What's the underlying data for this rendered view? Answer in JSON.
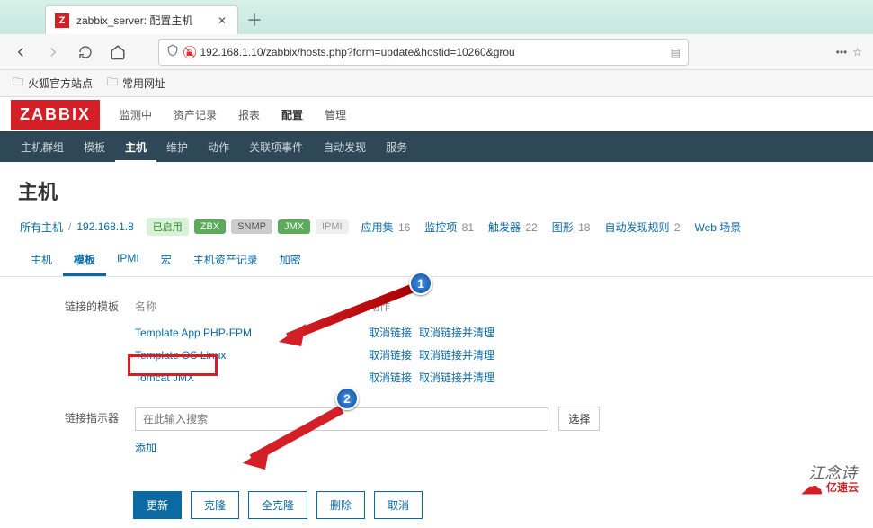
{
  "browser": {
    "tab_title": "zabbix_server: 配置主机",
    "url_readable": "192.168.1.10/zabbix/hosts.php?form=update&hostid=10260&grou",
    "bookmarks": [
      {
        "label": "火狐官方站点",
        "icon": "folder-icon"
      },
      {
        "label": "常用网址",
        "icon": "folder-icon"
      }
    ]
  },
  "zabbix": {
    "logo": "ZABBIX",
    "main_nav": [
      {
        "label": "监测中",
        "active": false
      },
      {
        "label": "资产记录",
        "active": false
      },
      {
        "label": "报表",
        "active": false
      },
      {
        "label": "配置",
        "active": true
      },
      {
        "label": "管理",
        "active": false
      }
    ],
    "sub_nav": [
      {
        "label": "主机群组"
      },
      {
        "label": "模板"
      },
      {
        "label": "主机",
        "active": true
      },
      {
        "label": "维护"
      },
      {
        "label": "动作"
      },
      {
        "label": "关联项事件"
      },
      {
        "label": "自动发现"
      },
      {
        "label": "服务"
      }
    ],
    "page_title": "主机",
    "crumb": {
      "all_hosts": "所有主机",
      "hostname": "192.168.1.8",
      "enabled": "已启用",
      "pills": {
        "zbx": "ZBX",
        "snmp": "SNMP",
        "jmx": "JMX",
        "ipmi": "IPMI"
      },
      "links": [
        {
          "label": "应用集",
          "count": "16"
        },
        {
          "label": "监控项",
          "count": "81"
        },
        {
          "label": "触发器",
          "count": "22"
        },
        {
          "label": "图形",
          "count": "18"
        },
        {
          "label": "自动发现规则",
          "count": "2"
        },
        {
          "label": "Web 场景",
          "count": ""
        }
      ]
    },
    "tabs": [
      {
        "label": "主机"
      },
      {
        "label": "模板",
        "active": true
      },
      {
        "label": "IPMI"
      },
      {
        "label": "宏"
      },
      {
        "label": "主机资产记录"
      },
      {
        "label": "加密"
      }
    ],
    "templates": {
      "section_label": "链接的模板",
      "headers": {
        "name": "名称",
        "action": "动作"
      },
      "rows": [
        {
          "name": "Template App PHP-FPM",
          "unlink": "取消链接",
          "clear": "取消链接并清理"
        },
        {
          "name": "Template OS Linux",
          "unlink": "取消链接",
          "clear": "取消链接并清理"
        },
        {
          "name": "Tomcat JMX",
          "unlink": "取消链接",
          "clear": "取消链接并清理",
          "highlight": true
        }
      ]
    },
    "link_indicator": {
      "section_label": "链接指示器",
      "placeholder": "在此输入搜索",
      "select": "选择",
      "add": "添加"
    },
    "buttons": {
      "update": "更新",
      "clone": "克隆",
      "fullclone": "全克隆",
      "delete": "删除",
      "cancel": "取消"
    }
  },
  "annotations": {
    "callout1": "1",
    "callout2": "2",
    "watermark_text": "江念诗",
    "watermark_brand": "亿速云"
  }
}
